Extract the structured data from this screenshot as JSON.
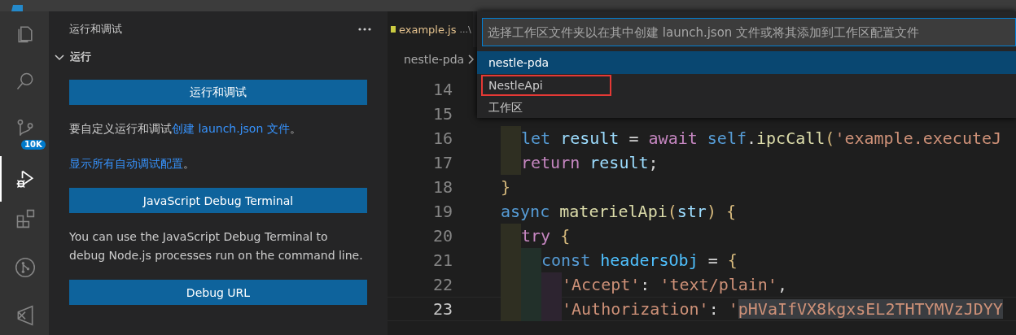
{
  "activity_bar": {
    "items": [
      {
        "kind": "files",
        "selected": false
      },
      {
        "kind": "search",
        "selected": false
      },
      {
        "kind": "source-control",
        "selected": false,
        "badge": "10K"
      },
      {
        "kind": "run-debug",
        "selected": true
      },
      {
        "kind": "extensions",
        "selected": false
      },
      {
        "kind": "git-graph",
        "selected": false
      },
      {
        "kind": "remote",
        "selected": false
      }
    ]
  },
  "sidebar": {
    "title": "运行和调试",
    "section": {
      "title": "运行",
      "expanded": true
    },
    "content": [
      {
        "kind": "button",
        "text": "运行和调试"
      },
      {
        "kind": "text",
        "text": "要自定义运行和调试",
        "link": "创建 launch.json 文件",
        "tail": "。"
      },
      {
        "kind": "link",
        "text": "显示所有自动调试配置",
        "tail": "。"
      },
      {
        "kind": "button",
        "text": "JavaScript Debug Terminal"
      },
      {
        "kind": "text",
        "text": "You can use the JavaScript Debug Terminal to debug Node.js processes run on the command line."
      },
      {
        "kind": "button",
        "text": "Debug URL"
      }
    ]
  },
  "editor": {
    "tab": {
      "label": "example.js",
      "description": "...\\"
    },
    "breadcrumb": "nestle-pda",
    "lines": [
      {
        "number": "14",
        "current": false
      },
      {
        "number": "15",
        "current": false
      },
      {
        "number": "16",
        "current": false,
        "tokens": [
          {
            "kind": "keyword",
            "text": "    let"
          },
          {
            "kind": "variable",
            "text": " result"
          },
          {
            "kind": "plain",
            "text": " = "
          },
          {
            "kind": "control",
            "text": "await"
          },
          {
            "kind": "keyword",
            "text": " self"
          },
          {
            "kind": "plain",
            "text": "."
          },
          {
            "kind": "function",
            "text": "ipcCall"
          },
          {
            "kind": "bracket",
            "text": "("
          },
          {
            "kind": "string",
            "text": "'example.executeJ"
          }
        ]
      },
      {
        "number": "17",
        "current": false,
        "tokens": [
          {
            "kind": "control",
            "text": "    return"
          },
          {
            "kind": "variable",
            "text": " result"
          },
          {
            "kind": "plain",
            "text": ";"
          }
        ]
      },
      {
        "number": "18",
        "current": false,
        "tokens": [
          {
            "kind": "bracket",
            "text": "  }"
          }
        ]
      },
      {
        "number": "19",
        "current": false,
        "tokens": [
          {
            "kind": "keyword",
            "text": "  async"
          },
          {
            "kind": "function",
            "text": " materielApi"
          },
          {
            "kind": "bracket",
            "text": "("
          },
          {
            "kind": "variable",
            "text": "str"
          },
          {
            "kind": "bracket",
            "text": ") "
          },
          {
            "kind": "bracket",
            "text": "{"
          }
        ]
      },
      {
        "number": "20",
        "current": false,
        "tokens": [
          {
            "kind": "control",
            "text": "    try "
          },
          {
            "kind": "bracket",
            "text": "{"
          }
        ]
      },
      {
        "number": "21",
        "current": false,
        "tokens": [
          {
            "kind": "keyword",
            "text": "      const"
          },
          {
            "kind": "constant",
            "text": " headersObj"
          },
          {
            "kind": "plain",
            "text": " = "
          },
          {
            "kind": "bracket",
            "text": "{"
          }
        ]
      },
      {
        "number": "22",
        "current": false,
        "tokens": [
          {
            "kind": "string",
            "text": "        'Accept'"
          },
          {
            "kind": "plain",
            "text": ": "
          },
          {
            "kind": "string",
            "text": "'text/plain'"
          },
          {
            "kind": "plain",
            "text": ","
          }
        ]
      },
      {
        "number": "23",
        "current": true,
        "tokens": [
          {
            "kind": "string",
            "text": "        'Authorization'"
          },
          {
            "kind": "plain",
            "text": ": "
          },
          {
            "kind": "string",
            "text": "'"
          },
          {
            "kind": "selected-string",
            "text": "pHVaIfVX8kgxsEL2THTYMVzJDYY"
          }
        ]
      }
    ]
  },
  "quick_pick": {
    "placeholder": "选择工作区文件夹以在其中创建 launch.json 文件或将其添加到工作区配置文件",
    "items": [
      {
        "label": "nestle-pda",
        "selected": true,
        "highlighted": false
      },
      {
        "label": "NestleApi",
        "selected": false,
        "highlighted": true
      },
      {
        "label": "工作区",
        "selected": false,
        "highlighted": false
      }
    ]
  }
}
